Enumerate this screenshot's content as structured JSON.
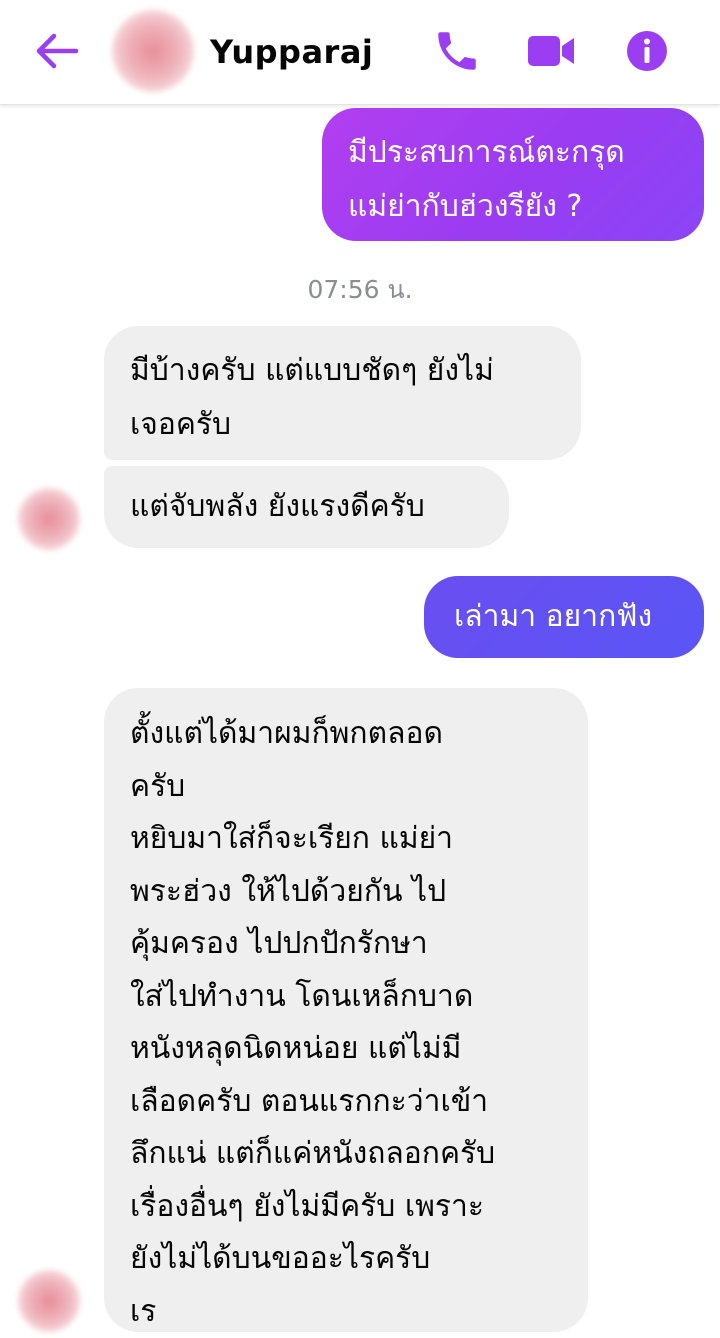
{
  "header": {
    "contact_name": "Yupparaj",
    "back_icon": "arrow-left-icon",
    "call_icon": "phone-icon",
    "video_icon": "video-camera-icon",
    "info_icon": "info-icon"
  },
  "colors": {
    "accent": "#9b3ef2",
    "outgoing_bubble_1": "#a53ff1",
    "outgoing_bubble_2": "#5f53f4",
    "incoming_bubble": "#efefef",
    "timestamp": "#8a8d91"
  },
  "messages": [
    {
      "direction": "outgoing",
      "text": "มีประสบการณ์ตะกรุด\nแม่ย่ากับฮ่วงรียัง ?"
    },
    {
      "type": "timestamp",
      "text": "07:56 น."
    },
    {
      "direction": "incoming",
      "text": "มีบ้างครับ แต่แบบชัดๆ ยังไม่\nเจอครับ"
    },
    {
      "direction": "incoming",
      "text": "แต่จับพลัง ยังแรงดีครับ"
    },
    {
      "direction": "outgoing",
      "text": "เล่ามา อยากฟัง"
    },
    {
      "direction": "incoming",
      "text": "ตั้งแต่ได้มาผมก็พกตลอด\nครับ\nหยิบมาใส่ก็จะเรียก แม่ย่า\nพระฮ่วง ให้ไปด้วยกัน ไป\nคุ้มครอง ไปปกปักรักษา\nใส่ไปทำงาน โดนเหล็กบาด\nหนังหลุดนิดหน่อย แต่ไม่มี\nเลือดครับ ตอนแรกกะว่าเข้า\nลึกแน่ แต่ก็แค่หนังถลอกครับ\nเรื่องอื่นๆ ยังไม่มีครับ เพราะ\nยังไม่ได้บนขออะไรครับ\nเร"
    }
  ]
}
